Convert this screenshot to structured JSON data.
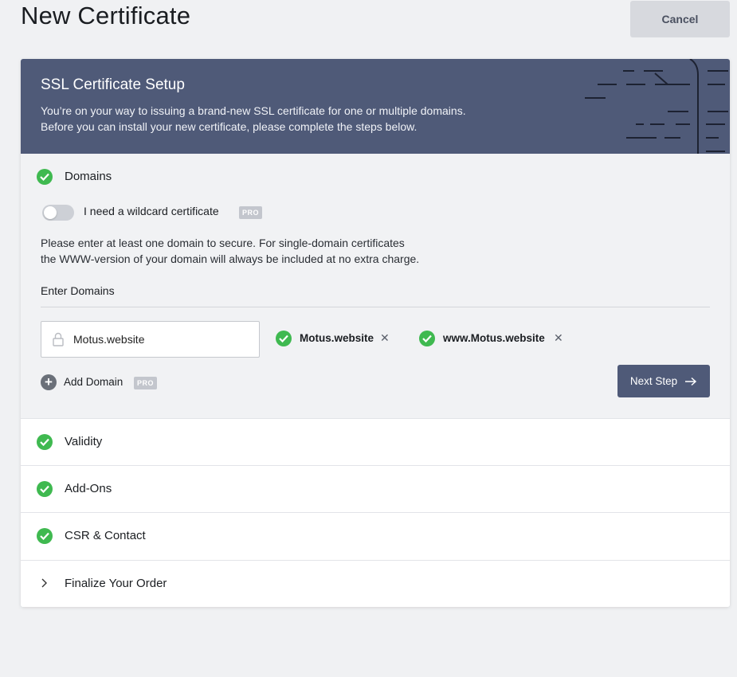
{
  "header": {
    "title": "New Certificate",
    "cancel_label": "Cancel"
  },
  "banner": {
    "title": "SSL Certificate Setup",
    "line1": "You’re on your way to issuing a brand-new SSL certificate for one or multiple domains.",
    "line2": "Before you can install your new certificate, please complete the steps below."
  },
  "domains": {
    "label": "Domains",
    "wildcard_label": "I need a wildcard certificate",
    "wildcard_enabled": false,
    "pro_badge": "PRO",
    "help_line1": "Please enter at least one domain to secure. For single-domain certificates",
    "help_line2": "the WWW-version of your domain will always be included at no extra charge.",
    "enter_label": "Enter Domains",
    "input_value": "Motus.website",
    "chips": [
      "Motus.website",
      "www.Motus.website"
    ],
    "add_domain_label": "Add Domain",
    "next_label": "Next Step"
  },
  "steps": [
    {
      "label": "Validity",
      "status": "complete"
    },
    {
      "label": "Add-Ons",
      "status": "complete"
    },
    {
      "label": "CSR & Contact",
      "status": "complete"
    },
    {
      "label": "Finalize Your Order",
      "status": "pending"
    }
  ],
  "colors": {
    "accent": "#4f5a78",
    "success": "#3fb950",
    "background": "#f0f1f3"
  }
}
